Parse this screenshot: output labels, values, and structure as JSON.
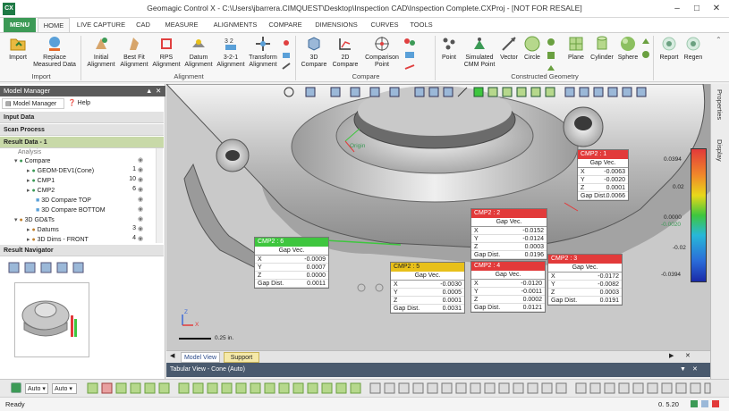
{
  "title": "Geomagic Control X - C:\\Users\\jbarrera.CIMQUEST\\Desktop\\Inspection CAD\\Inspection Complete.CXProj - [NOT FOR RESALE]",
  "app_logo": "CX",
  "tabs": [
    "MENU",
    "HOME",
    "LIVE CAPTURE",
    "CAD",
    "MEASURE",
    "ALIGNMENTS",
    "COMPARE",
    "DIMENSIONS",
    "CURVES",
    "TOOLS"
  ],
  "ribbon": {
    "import": {
      "label": "Import"
    },
    "replace": {
      "label1": "Replace",
      "label2": "Measured Data"
    },
    "initial": {
      "label1": "Initial",
      "label2": "Alignment"
    },
    "bestfit": {
      "label1": "Best Fit",
      "label2": "Alignment"
    },
    "rps": {
      "label1": "RPS",
      "label2": "Alignment"
    },
    "datum": {
      "label1": "Datum",
      "label2": "Alignment"
    },
    "three21": {
      "label1": "3-2-1",
      "label2": "Alignment"
    },
    "transform": {
      "label1": "Transform",
      "label2": "Alignment"
    },
    "compare3d": {
      "label1": "3D",
      "label2": "Compare"
    },
    "compare2d": {
      "label1": "2D",
      "label2": "Compare"
    },
    "comparison_point": {
      "label1": "Comparison",
      "label2": "Point"
    },
    "point": {
      "label": "Point"
    },
    "simulated": {
      "label1": "Simulated",
      "label2": "CMM Point"
    },
    "vector": {
      "label": "Vector"
    },
    "circle": {
      "label": "Circle"
    },
    "plane": {
      "label": "Plane"
    },
    "cylinder": {
      "label": "Cylinder"
    },
    "sphere": {
      "label": "Sphere"
    },
    "report": {
      "label": "Report"
    },
    "regen": {
      "label": "Regen"
    },
    "groups": {
      "import": "Import",
      "alignment": "Alignment",
      "compare": "Compare",
      "constructed": "Constructed Geometry"
    }
  },
  "model_manager": {
    "title": "Model Manager",
    "tab_manager": "Model Manager",
    "tab_help": "Help",
    "input_data": "Input Data",
    "scan_process": "Scan Process",
    "result_data": "Result Data - 1",
    "tree": [
      {
        "label": "Analysis",
        "count": ""
      },
      {
        "label": "Compare",
        "count": ""
      },
      {
        "label": "GEOM-DEV1(Cone)",
        "count": "1"
      },
      {
        "label": "CMP1",
        "count": "10"
      },
      {
        "label": "CMP2",
        "count": "6"
      },
      {
        "label": "3D Compare TOP",
        "count": ""
      },
      {
        "label": "3D Compare BOTTOM",
        "count": ""
      },
      {
        "label": "3D GD&Ts",
        "count": ""
      },
      {
        "label": "Datums",
        "count": "3"
      },
      {
        "label": "3D Dims - FRONT",
        "count": "4"
      }
    ],
    "result_navigator": "Result Navigator"
  },
  "viewport": {
    "origin_label": "Origin",
    "scale_label": "0.25 in.",
    "axis_x": "X",
    "axis_z": "Z",
    "callouts": [
      {
        "title": "CMP2 : 1",
        "color": "#e23a3a",
        "gap": "Gap Vec.",
        "x": "-0.0063",
        "y": "-0.0020",
        "z": "0.0001",
        "dist": "0.0066"
      },
      {
        "title": "CMP2 : 2",
        "color": "#e23a3a",
        "gap": "Gap Vec.",
        "x": "-0.0152",
        "y": "-0.0124",
        "z": "0.0003",
        "dist": "0.0196"
      },
      {
        "title": "CMP2 : 6",
        "color": "#3ec63e",
        "gap": "Gap Vec.",
        "x": "-0.0009",
        "y": "0.0007",
        "z": "0.0000",
        "dist": "0.0011"
      },
      {
        "title": "CMP2 : 5",
        "color": "#e8c01a",
        "gap": "Gap Vec.",
        "x": "-0.0030",
        "y": "0.0005",
        "z": "0.0001",
        "dist": "0.0031"
      },
      {
        "title": "CMP2 : 4",
        "color": "#e23a3a",
        "gap": "Gap Vec.",
        "x": "-0.0120",
        "y": "-0.0011",
        "z": "0.0002",
        "dist": "0.0121"
      },
      {
        "title": "CMP2 : 3",
        "color": "#e23a3a",
        "gap": "Gap Vec.",
        "x": "-0.0172",
        "y": "-0.0082",
        "z": "0.0003",
        "dist": "0.0191"
      }
    ],
    "row_labels": {
      "x": "X",
      "y": "Y",
      "z": "Z",
      "dist": "Gap Dist."
    },
    "colorbar": {
      "top": "0.0394",
      "mid1": "0.02",
      "mid2": "0.0000",
      "mid3": "-0.0020",
      "mid4": "-0.02",
      "bottom": "-0.0394"
    }
  },
  "view_tabs": {
    "model_view": "Model View",
    "support": "Support"
  },
  "tabular_view": "Tabular View - Cone (Auto)",
  "right_panels": {
    "properties": "Properties",
    "display": "Display"
  },
  "bottom_toolbar": {
    "combo1": "Auto",
    "combo2": "Auto"
  },
  "status": {
    "left": "Ready",
    "right": "0. 5.20"
  },
  "colors": {
    "accent": "#3c9a56",
    "error": "#e23a3a",
    "ok": "#3ec63e",
    "warn": "#e8c01a"
  }
}
